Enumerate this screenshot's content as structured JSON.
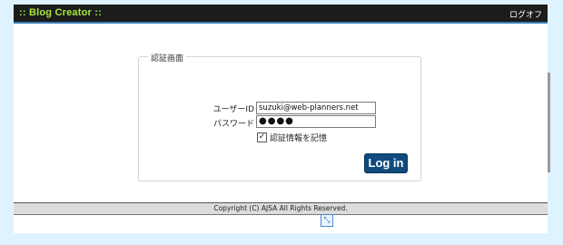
{
  "header": {
    "app_title": ":: Blog Creator ::",
    "logout_label": "ログオフ"
  },
  "login": {
    "section_title": "認証画面",
    "user_id_label": "ユーザーID",
    "user_id_value": "suzuki@web-planners.net",
    "password_label": "パスワード",
    "password_value": "●●●●",
    "remember_label": "認証情報を記憶",
    "remember_checked": true,
    "login_button": "Log in"
  },
  "footer": {
    "copyright": "Copyright (C) AJSA All Rights Reserved."
  },
  "icons": {
    "checkbox": "check-icon",
    "corner": "resize-icon"
  },
  "colors": {
    "app_title": "#a6e83a",
    "topbar": "#1c1c1c",
    "login_button": "#114a7e"
  }
}
